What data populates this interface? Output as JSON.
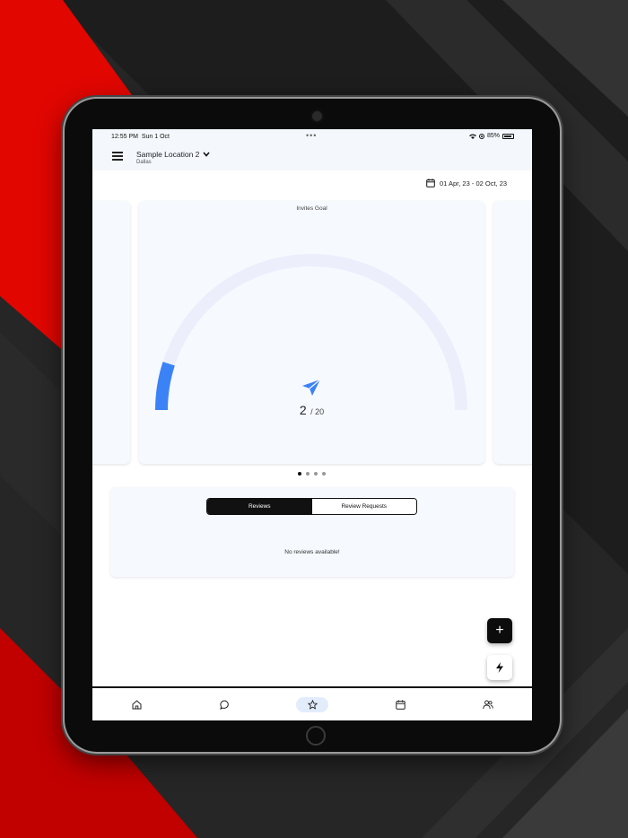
{
  "status_bar": {
    "time": "12:55 PM",
    "date": "Sun 1 Oct",
    "dots": "•••",
    "battery": "85%"
  },
  "header": {
    "location_name": "Sample Location 2",
    "location_city": "Dallas",
    "menu_icon": "hamburger-menu-icon",
    "dropdown_icon": "chevron-down-icon"
  },
  "date_filter": {
    "range": "01 Apr, 23 - 02 Oct, 23",
    "icon": "calendar-icon"
  },
  "goal_card": {
    "title": "Invites Goal",
    "current": "2",
    "separator": "/ 20",
    "progress_fraction": 0.1,
    "accent": "#3b82f6",
    "track": "#eceffb"
  },
  "carousel": {
    "pages": 4,
    "active_page": 1
  },
  "reviews": {
    "tabs": [
      {
        "label": "Reviews",
        "active": true
      },
      {
        "label": "Review Requests",
        "active": false
      }
    ],
    "empty_message": "No reviews available!"
  },
  "fabs": {
    "add": "+",
    "add_icon": "plus-icon",
    "bolt_icon": "lightning-icon"
  },
  "bottom_nav": {
    "items": [
      {
        "name": "home",
        "icon": "home-icon"
      },
      {
        "name": "messages",
        "icon": "chat-bubble-icon"
      },
      {
        "name": "reviews",
        "icon": "star-icon",
        "active": true
      },
      {
        "name": "calendar",
        "icon": "calendar-icon"
      },
      {
        "name": "contacts",
        "icon": "people-icon"
      }
    ]
  },
  "colors": {
    "screen_header_bg": "#f4f8fd",
    "card_bg": "#f6f9fe",
    "active_nav_pill": "#e2ecfb",
    "background_red": "#e10600"
  }
}
